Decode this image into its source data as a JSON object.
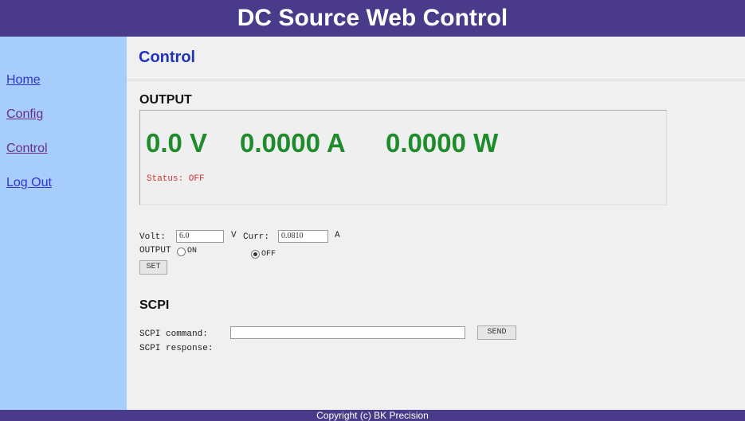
{
  "header": {
    "title": "DC Source Web Control"
  },
  "sidebar": {
    "items": [
      {
        "label": "Home"
      },
      {
        "label": "Config"
      },
      {
        "label": "Control"
      },
      {
        "label": "Log Out"
      }
    ]
  },
  "main": {
    "page_title": "Control",
    "output": {
      "heading": "OUTPUT",
      "voltage": "0.0 V",
      "current": "0.0000 A",
      "power": "0.0000 W",
      "status": "Status: OFF"
    },
    "settings": {
      "volt_label": "Volt:",
      "volt_value": "6.0",
      "volt_unit": "V",
      "curr_label": "Curr:",
      "curr_value": "0.0810",
      "curr_unit": "A",
      "output_label": "OUTPUT",
      "on_label": "ON",
      "off_label": "OFF",
      "output_state": "OFF",
      "set_label": "SET"
    },
    "scpi": {
      "heading": "SCPI",
      "command_label": "SCPI command:",
      "command_value": "",
      "send_label": "SEND",
      "response_label": "SCPI response:"
    }
  },
  "footer": {
    "copyright": "Copyright (c) BK Precision"
  },
  "colors": {
    "header_bg": "#4a3a8a",
    "sidebar_bg": "#a7cdfd",
    "reading_green": "#1e8c2a",
    "status_red": "#d03030",
    "title_blue": "#2233bb"
  }
}
